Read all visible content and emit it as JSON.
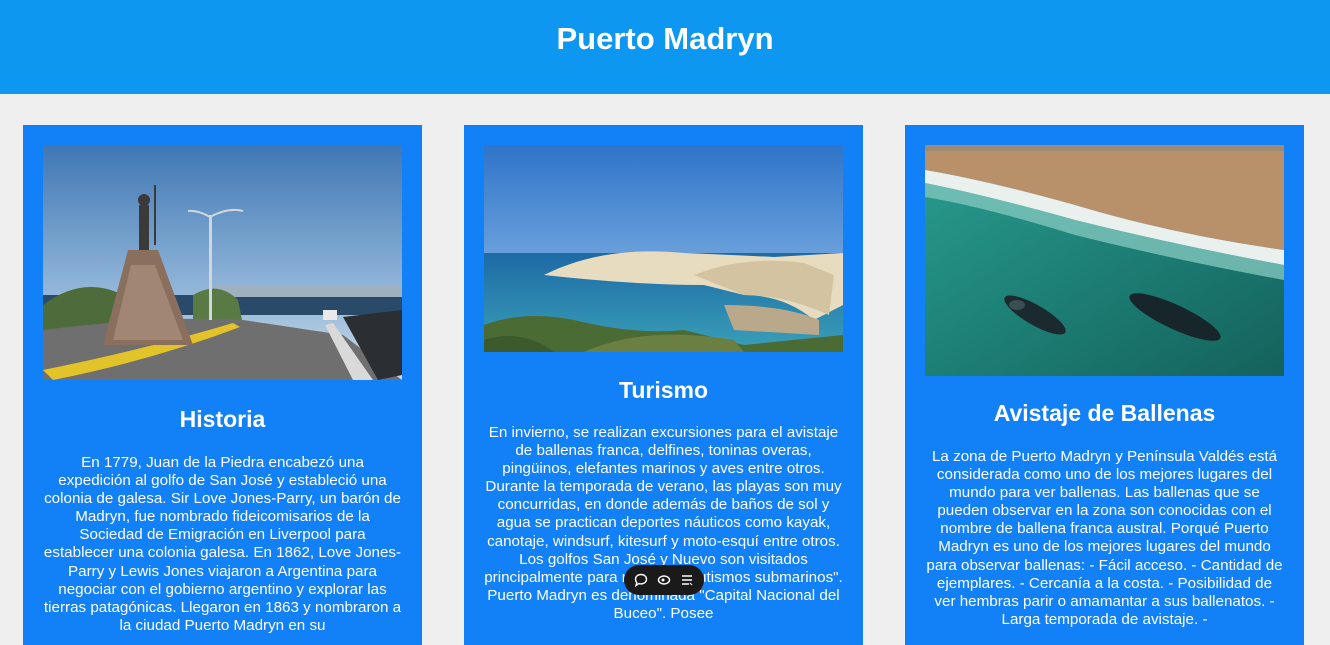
{
  "header": {
    "title": "Puerto Madryn"
  },
  "cards": [
    {
      "title": "Historia",
      "text": "En 1779, Juan de la Piedra encabezó una expedición al golfo de San José y estableció una colonia de galesa. Sir Love Jones-Parry, un barón de Madryn, fue nombrado fideicomisarios de la Sociedad de Emigración en Liverpool para establecer una colonia galesa. En 1862, Love Jones-Parry y Lewis Jones viajaron a Argentina para negociar con el gobierno argentino y explorar las tierras patagónicas. Llegaron en 1863 y nombraron a la ciudad Puerto Madryn en su"
    },
    {
      "title": "Turismo",
      "text": "En invierno, se realizan excursiones para el avistaje de ballenas franca, delfines, toninas overas, pingüinos, elefantes marinos y aves entre otros. Durante la temporada de verano, las playas son muy concurridas, en donde además de baños de sol y agua se practican deportes náuticos como kayak, canotaje, windsurf, kitesurf y moto-esquí entre otros. Los golfos San José y Nuevo son visitados principalmente para realizar \"bautismos submarinos\". Puerto Madryn es denominada \"Capital Nacional del Buceo\". Posee"
    },
    {
      "title": "Avistaje de Ballenas",
      "text": "La zona de Puerto Madryn y Península Valdés está considerada como uno de los mejores lugares del mundo para ver ballenas. Las ballenas que se pueden observar en la zona son conocidas con el nombre de ballena franca austral. Porqué Puerto Madryn es uno de los mejores lugares del mundo para observar ballenas: - Fácil acceso. - Cantidad de ejemplares. - Cercanía a la costa. - Posibilidad de ver hembras parir o amamantar a sus ballenatos. - Larga temporada de avistaje. -"
    }
  ],
  "toolbar": {
    "icons": [
      "comment-icon",
      "eye-icon",
      "list-icon"
    ]
  },
  "colors": {
    "header": "#0e97f0",
    "card": "#1280f6",
    "background": "#efefef"
  }
}
